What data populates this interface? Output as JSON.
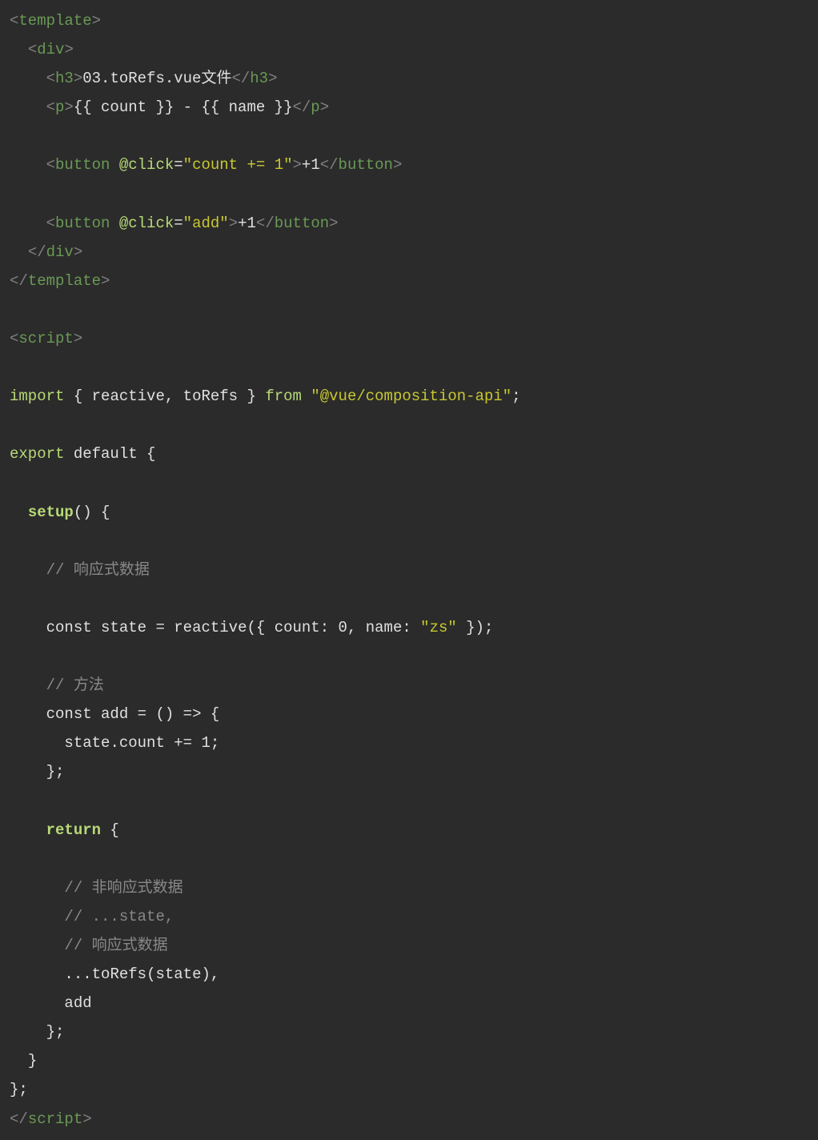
{
  "lines": {
    "l1_open": "<",
    "l1_tag": "template",
    "l1_close": ">",
    "l2_open": "<",
    "l2_tag": "div",
    "l2_close": ">",
    "l3_open": "<",
    "l3_tag": "h3",
    "l3_gt": ">",
    "l3_text": "03.toRefs.vue文件",
    "l3_open2": "</",
    "l3_tag2": "h3",
    "l3_close2": ">",
    "l4_open": "<",
    "l4_tag": "p",
    "l4_gt": ">",
    "l4_text1": "{{ count }} - {{ name }}",
    "l4_open2": "</",
    "l4_tag2": "p",
    "l4_close2": ">",
    "l5_open": "<",
    "l5_tag": "button",
    "l5_sp": " ",
    "l5_attr": "@click",
    "l5_eq": "=",
    "l5_q1": "\"",
    "l5_val": "count += 1",
    "l5_q2": "\"",
    "l5_gt": ">",
    "l5_text": "+1",
    "l5_open2": "</",
    "l5_tag2": "button",
    "l5_close2": ">",
    "l6_open": "<",
    "l6_tag": "button",
    "l6_sp": " ",
    "l6_attr": "@click",
    "l6_eq": "=",
    "l6_q1": "\"",
    "l6_val": "add",
    "l6_q2": "\"",
    "l6_gt": ">",
    "l6_text": "+1",
    "l6_open2": "</",
    "l6_tag2": "button",
    "l6_close2": ">",
    "l7_open": "</",
    "l7_tag": "div",
    "l7_close": ">",
    "l8_open": "</",
    "l8_tag": "template",
    "l8_close": ">",
    "l9_open": "<",
    "l9_tag": "script",
    "l9_close": ">",
    "l10_import": "import",
    "l10_sp1": " { ",
    "l10_reactive": "reactive",
    "l10_comma": ", ",
    "l10_torefs": "toRefs",
    "l10_sp2": " } ",
    "l10_from": "from",
    "l10_sp3": " ",
    "l10_q1": "\"",
    "l10_pkg": "@vue/composition-api",
    "l10_q2": "\"",
    "l10_semi": ";",
    "l11_export": "export",
    "l11_sp": " ",
    "l11_default": "default",
    "l11_brace": " {",
    "l12_setup": "setup",
    "l12_paren": "() {",
    "l13_comment": "// 响应式数据",
    "l14_const": "const",
    "l14_sp1": " ",
    "l14_state": "state",
    "l14_sp2": " ",
    "l14_eq": "=",
    "l14_sp3": " ",
    "l14_reactive": "reactive",
    "l14_paren1": "({ ",
    "l14_count": "count",
    "l14_colon1": ": ",
    "l14_zero": "0",
    "l14_comma": ", ",
    "l14_name": "name",
    "l14_colon2": ": ",
    "l14_q1": "\"",
    "l14_zs": "zs",
    "l14_q2": "\"",
    "l14_paren2": " });",
    "l15_comment": "// 方法",
    "l16_const": "const",
    "l16_sp1": " ",
    "l16_add": "add",
    "l16_sp2": " ",
    "l16_eq": "=",
    "l16_sp3": " () ",
    "l16_arrow": "=>",
    "l16_brace": " {",
    "l17_state": "state",
    "l17_dot": ".",
    "l17_count": "count",
    "l17_sp": " ",
    "l17_op": "+=",
    "l17_sp2": " ",
    "l17_one": "1",
    "l17_semi": ";",
    "l18_close": "};",
    "l19_return": "return",
    "l19_brace": " {",
    "l20_comment": "// 非响应式数据",
    "l21_comment": "// ...state,",
    "l22_comment": "// 响应式数据",
    "l23_spread": "...",
    "l23_torefs": "toRefs",
    "l23_paren1": "(",
    "l23_state": "state",
    "l23_paren2": "),",
    "l24_add": "add",
    "l25_close": "};",
    "l26_close": "}",
    "l27_close": "};",
    "l28_open": "</",
    "l28_tag": "script",
    "l28_close": ">"
  }
}
